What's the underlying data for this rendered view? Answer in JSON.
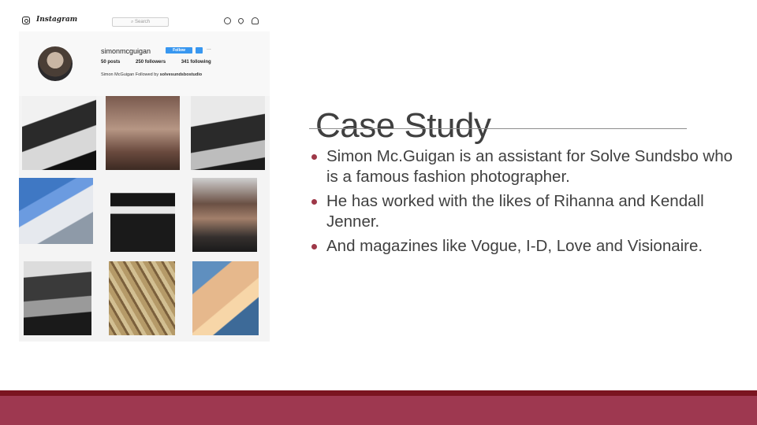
{
  "instagram": {
    "wordmark": "Instagram",
    "search_placeholder": "Search",
    "username": "simonmcguigan",
    "follow_label": "Follow",
    "more_label": "...",
    "stats": {
      "posts": "50 posts",
      "followers": "250 followers",
      "following": "341 following"
    },
    "bio": {
      "name": "Simon McGuigan",
      "followed_by_label": "Followed by",
      "followed_by_user": "solvesundsbostudio"
    },
    "icons": [
      "instagram-logo-icon",
      "compass-icon",
      "heart-icon",
      "user-icon"
    ]
  },
  "slide": {
    "title": "Case Study",
    "bullets": [
      "Simon Mc.Guigan is an assistant for Solve Sundsbo who is a famous fashion photographer.",
      "He has worked with the likes of Rihanna and Kendall Jenner.",
      "And magazines like Vogue, I-D, Love and Visionaire."
    ]
  },
  "colors": {
    "bullet": "#9e3848",
    "footer_line": "#7b1420",
    "footer_band": "#9e3850",
    "follow_button": "#3897f0"
  }
}
